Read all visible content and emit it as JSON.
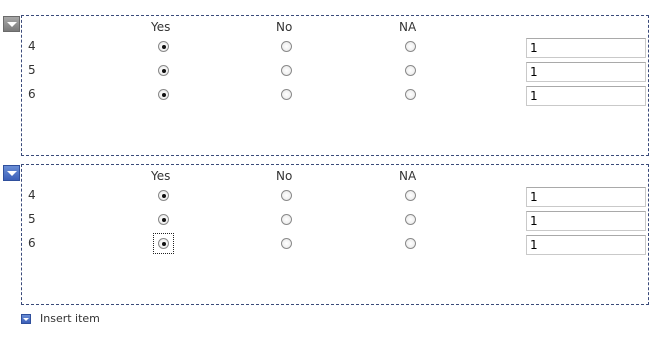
{
  "sections": [
    {
      "headers": {
        "yes": "Yes",
        "no": "No",
        "na": "NA"
      },
      "rows": [
        {
          "label": "4",
          "selected": "yes",
          "value": "1"
        },
        {
          "label": "5",
          "selected": "yes",
          "value": "1"
        },
        {
          "label": "6",
          "selected": "yes",
          "value": "1"
        }
      ]
    },
    {
      "headers": {
        "yes": "Yes",
        "no": "No",
        "na": "NA"
      },
      "rows": [
        {
          "label": "4",
          "selected": "yes",
          "value": "1"
        },
        {
          "label": "5",
          "selected": "yes",
          "value": "1"
        },
        {
          "label": "6",
          "selected": "yes",
          "value": "1"
        }
      ]
    }
  ],
  "insert_item": {
    "label": "Insert item",
    "icon": "down-arrow-icon"
  },
  "colors": {
    "accent_blue": "#3b5fb8",
    "gray_handle": "#7a7a7a",
    "border": "#3a4a7a"
  }
}
